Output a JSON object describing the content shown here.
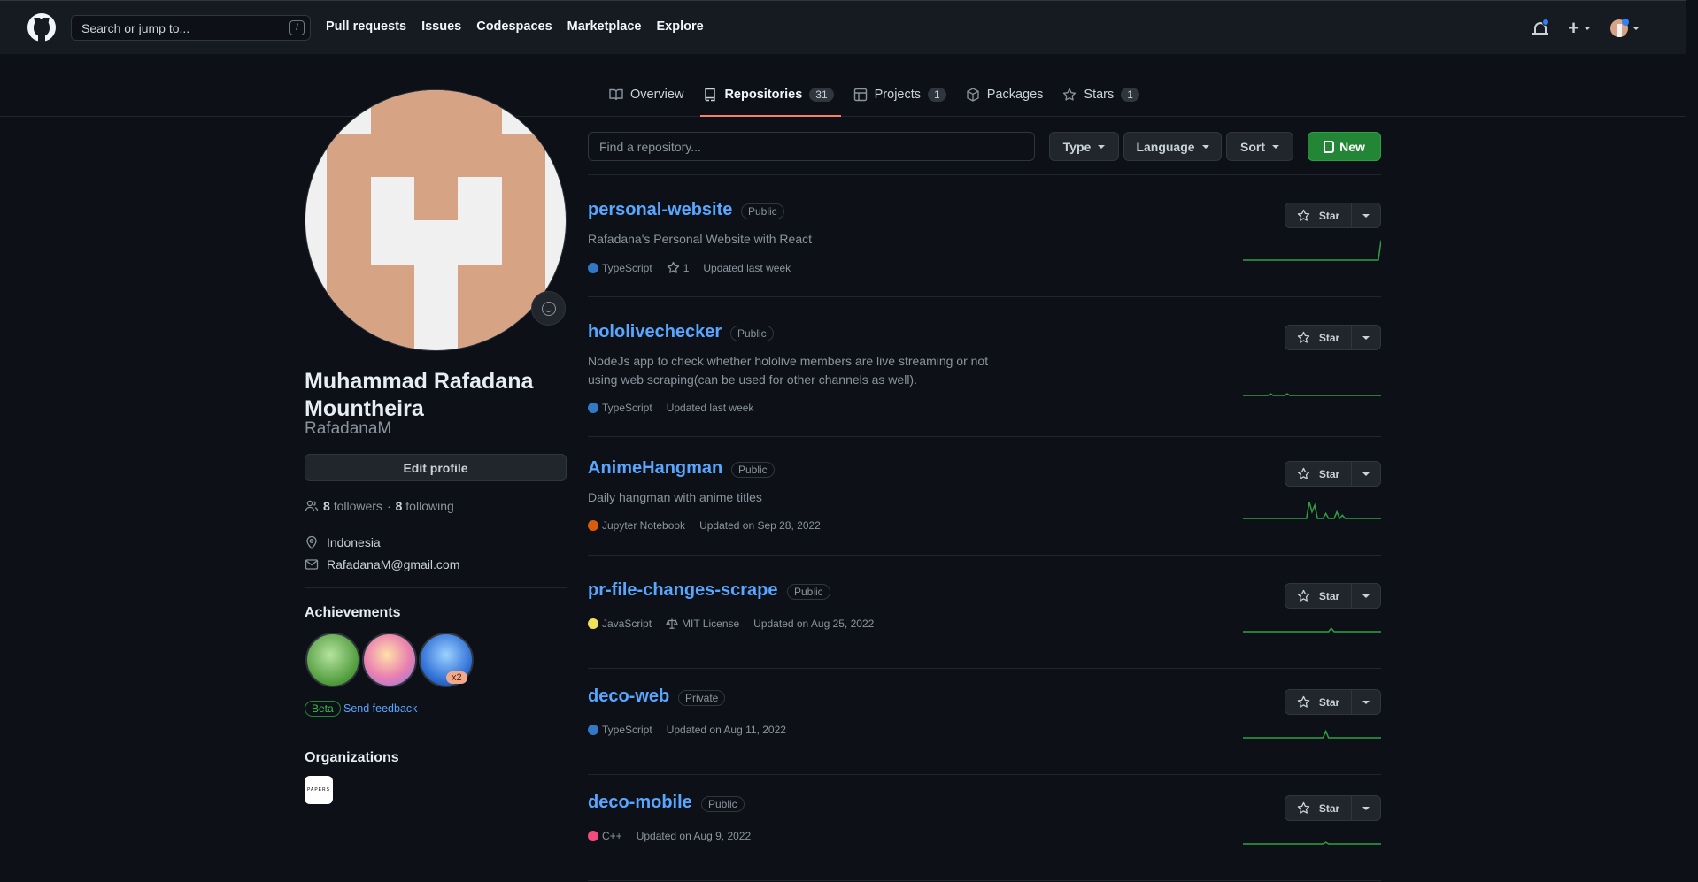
{
  "header": {
    "search_placeholder": "Search or jump to...",
    "search_shortcut": "/",
    "nav": [
      "Pull requests",
      "Issues",
      "Codespaces",
      "Marketplace",
      "Explore"
    ],
    "plus": "+"
  },
  "tabs": [
    {
      "label": "Overview",
      "icon": "book-icon"
    },
    {
      "label": "Repositories",
      "count": "31",
      "icon": "repo-icon",
      "active": true
    },
    {
      "label": "Projects",
      "count": "1",
      "icon": "table-icon"
    },
    {
      "label": "Packages",
      "icon": "package-icon"
    },
    {
      "label": "Stars",
      "count": "1",
      "icon": "star-icon"
    }
  ],
  "profile": {
    "fullname": "Muhammad Rafadana Mountheira",
    "username": "RafadanaM",
    "edit_label": "Edit profile",
    "followers": "8",
    "followers_label": "followers",
    "dot": "·",
    "following": "8",
    "following_label": "following",
    "location": "Indonesia",
    "email": "RafadanaM@gmail.com",
    "achievements_title": "Achievements",
    "achievement_multiplier": "x2",
    "beta_label": "Beta",
    "feedback_label": "Send feedback",
    "organizations_title": "Organizations",
    "org_logo_text": "PAPERS"
  },
  "filters": {
    "find_placeholder": "Find a repository...",
    "type": "Type",
    "language": "Language",
    "sort": "Sort",
    "new": "New"
  },
  "repos": [
    {
      "name": "personal-website",
      "visibility": "Public",
      "description": "Rafadana's Personal Website with React",
      "language": "TypeScript",
      "lang_color": "#3178c6",
      "stars": "1",
      "updated": "Updated last week",
      "activity": [
        0,
        0,
        0,
        0,
        0,
        0,
        0,
        0,
        0,
        0,
        0,
        0,
        0,
        0,
        0,
        0,
        0,
        0,
        0,
        0,
        0,
        0,
        0,
        0,
        0,
        0,
        0,
        0,
        0,
        0,
        0,
        0,
        0,
        0,
        0,
        0,
        0,
        0,
        0,
        0,
        0,
        0,
        0,
        0,
        0,
        0,
        0,
        0,
        0,
        0,
        12
      ]
    },
    {
      "name": "hololivechecker",
      "visibility": "Public",
      "description": "NodeJs app to check whether hololive members are live streaming or not using web scraping(can be used for other channels as well).",
      "language": "TypeScript",
      "lang_color": "#3178c6",
      "updated": "Updated last week",
      "activity": [
        0,
        0,
        0,
        0,
        0,
        0,
        0,
        0,
        0,
        0,
        1,
        0,
        0,
        0,
        0,
        0,
        1,
        0,
        0,
        0,
        0,
        0,
        0,
        0,
        0,
        0,
        0,
        0,
        0,
        0,
        0,
        0,
        0,
        0,
        0,
        0,
        0,
        0,
        0,
        0,
        0,
        0,
        0,
        0,
        0,
        0,
        0,
        0,
        0,
        0,
        0
      ]
    },
    {
      "name": "AnimeHangman",
      "visibility": "Public",
      "description": "Daily hangman with anime titles",
      "language": "Jupyter Notebook",
      "lang_color": "#da5b0b",
      "updated": "Updated on Sep 28, 2022",
      "activity": [
        0,
        0,
        0,
        0,
        0,
        0,
        0,
        0,
        0,
        0,
        0,
        0,
        0,
        0,
        0,
        0,
        0,
        0,
        0,
        0,
        0,
        0,
        0,
        0,
        10,
        4,
        8,
        0,
        0,
        0,
        3,
        0,
        0,
        0,
        4,
        0,
        2,
        0,
        0,
        0,
        0,
        0,
        0,
        0,
        0,
        0,
        0,
        0,
        0,
        0,
        0
      ]
    },
    {
      "name": "pr-file-changes-scrape",
      "visibility": "Public",
      "language": "JavaScript",
      "lang_color": "#f1e05a",
      "license": "MIT License",
      "updated": "Updated on Aug 25, 2022",
      "activity": [
        0,
        0,
        0,
        0,
        0,
        0,
        0,
        0,
        0,
        0,
        0,
        0,
        0,
        0,
        0,
        0,
        0,
        0,
        0,
        0,
        0,
        0,
        0,
        0,
        0,
        0,
        0,
        0,
        0,
        0,
        0,
        0,
        2,
        0,
        0,
        0,
        0,
        0,
        0,
        0,
        0,
        0,
        0,
        0,
        0,
        0,
        0,
        0,
        0,
        0,
        0
      ]
    },
    {
      "name": "deco-web",
      "visibility": "Private",
      "language": "TypeScript",
      "lang_color": "#3178c6",
      "updated": "Updated on Aug 11, 2022",
      "activity": [
        0,
        0,
        0,
        0,
        0,
        0,
        0,
        0,
        0,
        0,
        0,
        0,
        0,
        0,
        0,
        0,
        0,
        0,
        0,
        0,
        0,
        0,
        0,
        0,
        0,
        0,
        0,
        0,
        0,
        0,
        4,
        0,
        0,
        0,
        0,
        0,
        0,
        0,
        0,
        0,
        0,
        0,
        0,
        0,
        0,
        0,
        0,
        0,
        0,
        0,
        0
      ]
    },
    {
      "name": "deco-mobile",
      "visibility": "Public",
      "language": "C++",
      "lang_color": "#f34b7d",
      "updated": "Updated on Aug 9, 2022",
      "activity": [
        0,
        0,
        0,
        0,
        0,
        0,
        0,
        0,
        0,
        0,
        0,
        0,
        0,
        0,
        0,
        0,
        0,
        0,
        0,
        0,
        0,
        0,
        0,
        0,
        0,
        0,
        0,
        0,
        0,
        0,
        1,
        0,
        0,
        0,
        0,
        0,
        0,
        0,
        0,
        0,
        0,
        0,
        0,
        0,
        0,
        0,
        0,
        0,
        0,
        0,
        0
      ]
    }
  ],
  "star_label": "Star",
  "colors": {
    "accent": "#f78166",
    "link": "#58a6ff",
    "new_button": "#238636",
    "spark": "#2ea043"
  }
}
